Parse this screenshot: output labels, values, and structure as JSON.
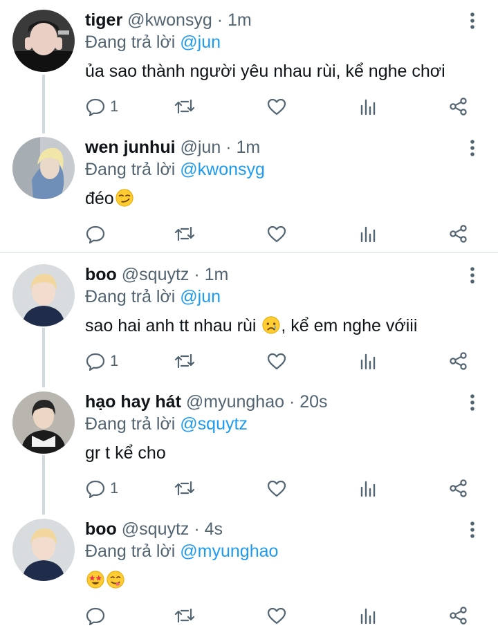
{
  "replying_label": "Đang trả lời",
  "tweets": [
    {
      "name": "tiger",
      "handle": "@kwonsyg",
      "dot": "·",
      "time": "1m",
      "replying_to": "@jun",
      "text": "ủa sao thành người yêu nhau rùi, kể nghe chơi",
      "reply_count": "1"
    },
    {
      "name": "wen junhui",
      "handle": "@jun",
      "dot": "·",
      "time": "1m",
      "replying_to": "@kwonsyg",
      "text": "đéo",
      "emoji": [
        "smirking-face"
      ],
      "reply_count": ""
    },
    {
      "name": "boo",
      "handle": "@squytz",
      "dot": "·",
      "time": "1m",
      "replying_to": "@jun",
      "text": "sao hai anh tt nhau rùi",
      "text_after": ", kể em nghe vớiii",
      "emoji": [
        "crying-face"
      ],
      "reply_count": "1"
    },
    {
      "name": "hạo hay hát",
      "handle": "@myunghao",
      "dot": "·",
      "time": "20s",
      "replying_to": "@squytz",
      "text": "gr t kể cho",
      "reply_count": "1"
    },
    {
      "name": "boo",
      "handle": "@squytz",
      "dot": "·",
      "time": "4s",
      "replying_to": "@myunghao",
      "text": "",
      "emoji": [
        "star-struck",
        "face-savoring-food"
      ],
      "reply_count": ""
    }
  ],
  "colors": {
    "accent": "#1d9bf0",
    "secondary_text": "#536471",
    "icon": "#536471",
    "thread_line": "#cfd9de"
  }
}
